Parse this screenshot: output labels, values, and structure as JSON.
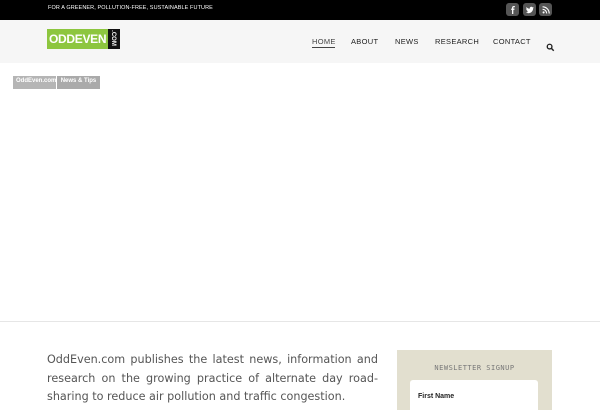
{
  "topbar": {
    "tagline": "FOR A GREENER, POLLUTION-FREE, SUSTAINABLE FUTURE",
    "social": [
      "facebook-icon",
      "twitter-icon",
      "rss-icon"
    ]
  },
  "logo": {
    "main": "ODDEVEN",
    "tld": ".COM"
  },
  "nav": {
    "items": [
      {
        "label": "HOME",
        "active": true
      },
      {
        "label": "ABOUT",
        "active": false
      },
      {
        "label": "NEWS",
        "active": false
      },
      {
        "label": "RESEARCH",
        "active": false
      },
      {
        "label": "CONTACT",
        "active": false
      }
    ],
    "search_icon": "search-icon"
  },
  "hero": {
    "breadcrumbs": [
      "OddEven.com",
      "News & Tips"
    ]
  },
  "intro": {
    "text": "OddEven.com publishes the latest news, information and research on the growing practice of alternate day road-sharing to reduce air pollution and traffic congestion."
  },
  "newsletter": {
    "title": "NEWSLETTER SIGNUP",
    "first_name_label": "First Name"
  },
  "colors": {
    "brand_green": "#8dc63f",
    "topbar": "#000000",
    "header": "#f6f6f6",
    "newsletter_bg": "#e2dfcf"
  }
}
